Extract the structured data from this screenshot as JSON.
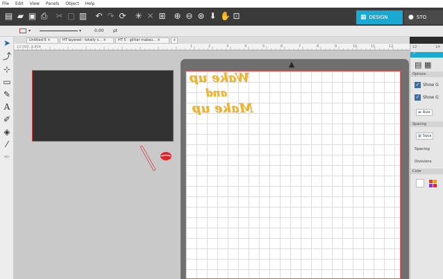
{
  "menu": [
    "File",
    "Edit",
    "View",
    "Panels",
    "Object",
    "Help"
  ],
  "top_buttons": {
    "design": "DESIGN",
    "store": "STO"
  },
  "stylebar": {
    "line_width": "0.00",
    "unit": "pt"
  },
  "tabs": [
    {
      "label": "Untitled-5"
    },
    {
      "label": "HT layered - totally c..."
    },
    {
      "label": "HT 5 - glitter makeu..."
    }
  ],
  "ruler": {
    "coord": "12.000, 3.804",
    "ticks": [
      "1",
      "2",
      "3",
      "4",
      "5",
      "6",
      "7",
      "8",
      "9",
      "10",
      "11",
      "12"
    ]
  },
  "wordart": {
    "line1": "Wake up",
    "line2": "and",
    "line3": "Make up"
  },
  "right_panel": {
    "tabs_top": [
      "12",
      "14"
    ],
    "options_header": "Options",
    "show1": "Show G",
    "show2": "Show G",
    "style_btn": "Rule",
    "spacing_header": "Spacing",
    "square_btn": "Squa",
    "spacing_label": "Spacing",
    "divisions_label": "Divisions",
    "color_header": "Color"
  },
  "colors": {
    "accent": "#1aa9d3",
    "mat_border": "#d96060",
    "wordart": "#f0b429",
    "lips": "#e8202a"
  }
}
